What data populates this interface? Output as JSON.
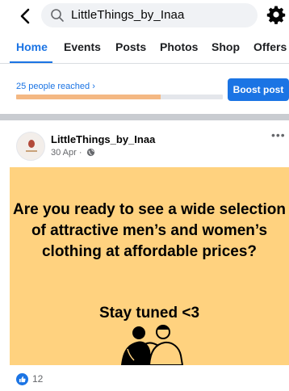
{
  "search": {
    "query": "LittleThings_by_Inaa"
  },
  "tabs": [
    {
      "label": "Home",
      "active": true
    },
    {
      "label": "Events"
    },
    {
      "label": "Posts"
    },
    {
      "label": "Photos"
    },
    {
      "label": "Shop"
    },
    {
      "label": "Offers"
    }
  ],
  "insights": {
    "reach_text": "25 people reached ›",
    "progress_fraction": 0.7,
    "boost_label": "Boost post"
  },
  "post": {
    "page_name": "LittleThings_by_Inaa",
    "date": "30 Apr ·",
    "more": "•••",
    "image": {
      "headline": "Are you ready to see a wide selection of attractive men’s and women’s clothing at affordable prices?",
      "tagline": "Stay tuned <3"
    },
    "likes": "12"
  },
  "colors": {
    "accent": "#1b74e4",
    "post_background": "#ffd27f",
    "progress": "#f4b883"
  },
  "icons": [
    "back-arrow-icon",
    "search-icon",
    "gear-icon",
    "globe-icon",
    "more-icon",
    "like-icon"
  ]
}
